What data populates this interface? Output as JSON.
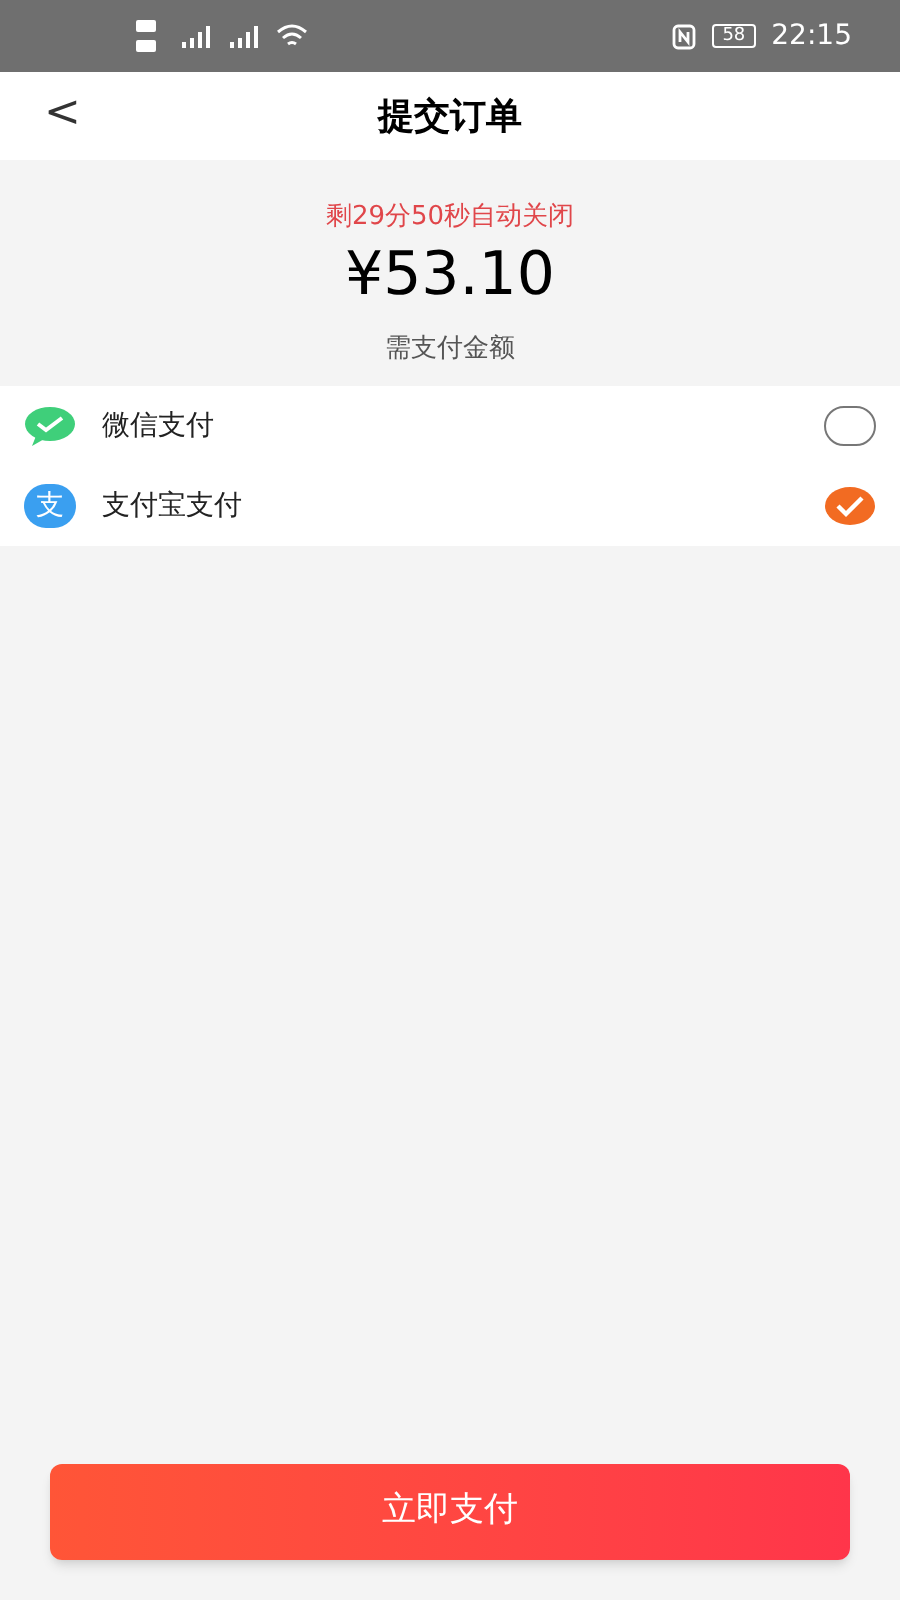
{
  "status_bar": {
    "battery": "58",
    "time": "22:15"
  },
  "header": {
    "back": "<",
    "title": "提交订单"
  },
  "summary": {
    "countdown": "剩29分50秒自动关闭",
    "amount": "¥53.10",
    "label": "需支付金额"
  },
  "payment_methods": [
    {
      "kind": "wechat",
      "label": "微信支付",
      "selected": false
    },
    {
      "kind": "alipay",
      "label": "支付宝支付",
      "selected": true,
      "icon_text": "支"
    }
  ],
  "pay_button": "立即支付"
}
